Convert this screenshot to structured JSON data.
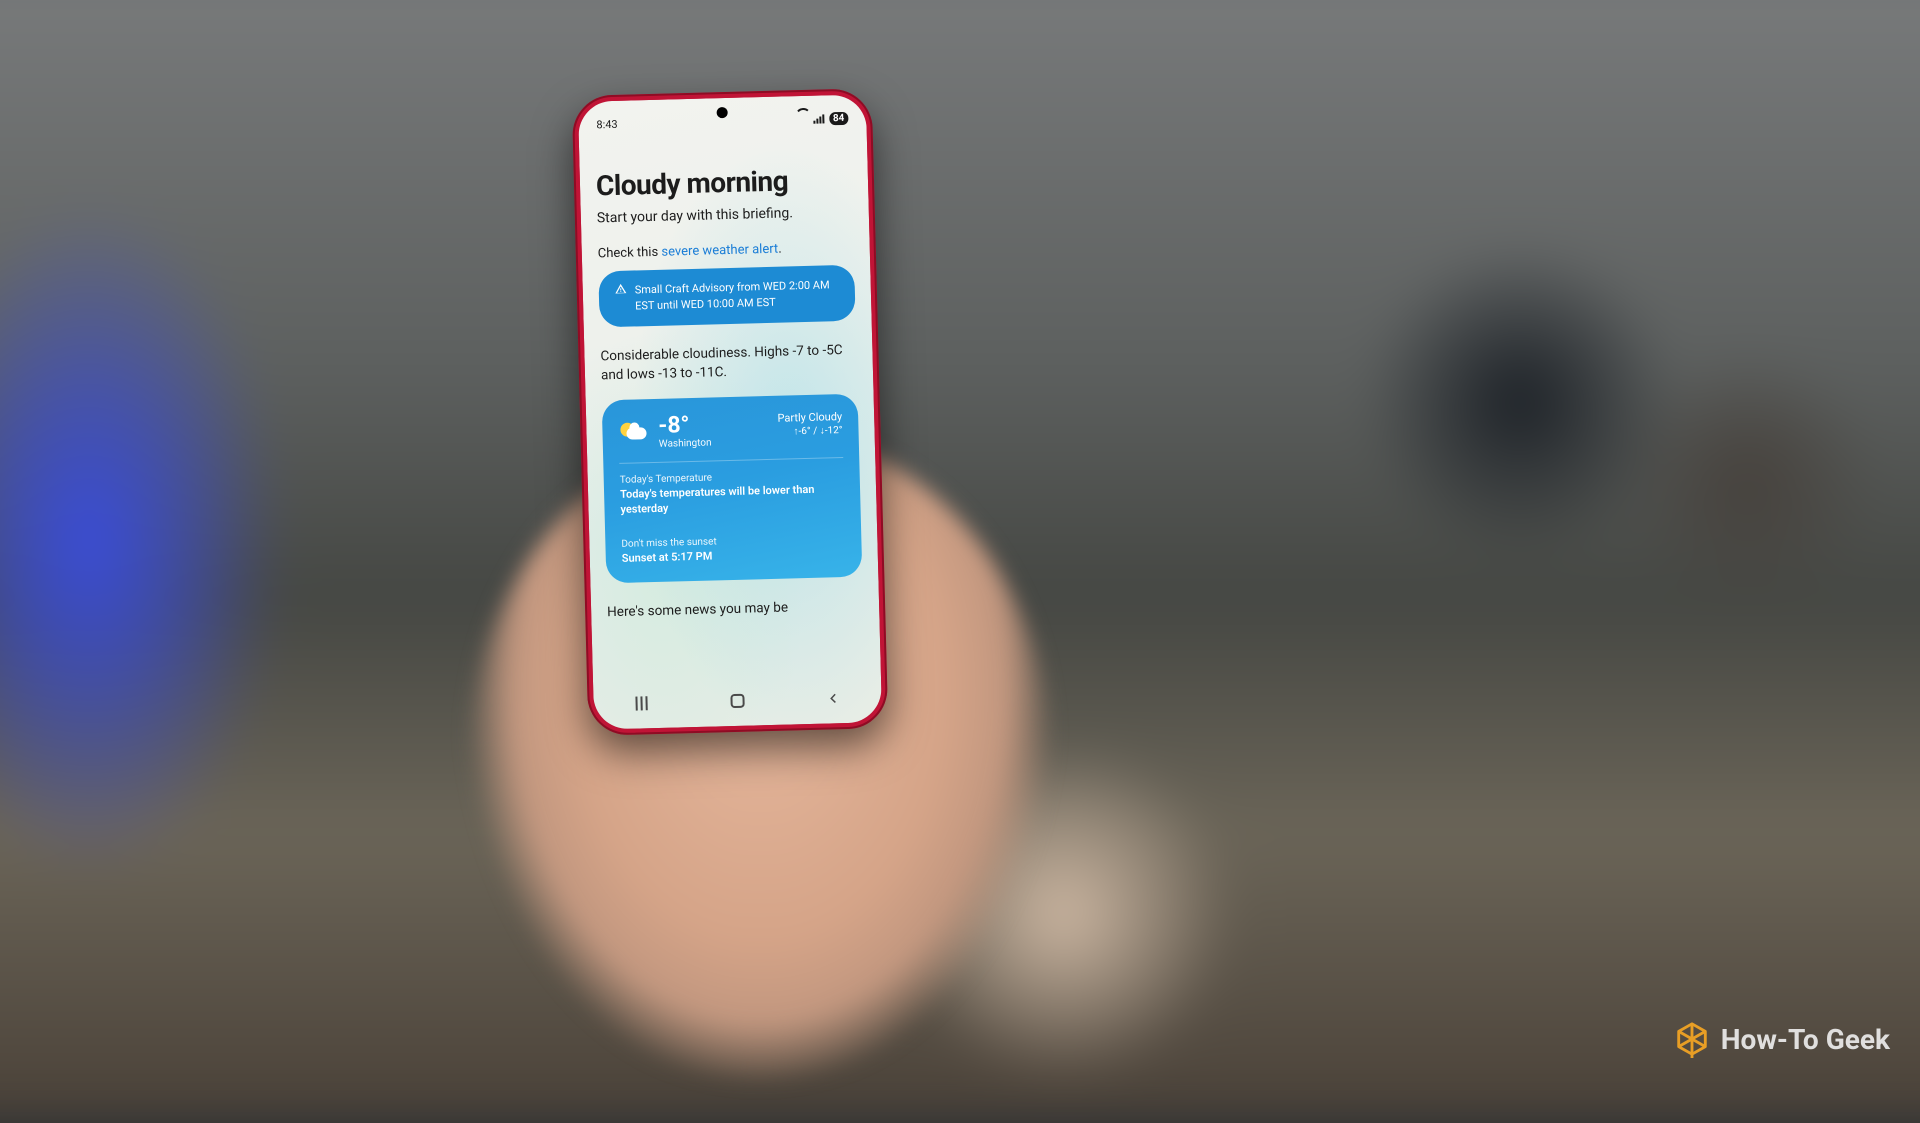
{
  "watermark": "How-To Geek",
  "status": {
    "time": "8:43",
    "battery": "84"
  },
  "briefing": {
    "title": "Cloudy morning",
    "subtitle": "Start your day with this briefing.",
    "check_prefix": "Check this ",
    "check_link": "severe weather alert",
    "check_suffix": ".",
    "advisory": "Small Craft Advisory from WED 2:00 AM EST until WED 10:00 AM EST",
    "forecast": "Considerable cloudiness. Highs -7 to -5C and lows -13 to -11C.",
    "news_lead": "Here's some news you may be"
  },
  "weather": {
    "temp": "-8°",
    "location": "Washington",
    "condition": "Partly Cloudy",
    "hilo": "↑-6° / ↓-12°",
    "today_label": "Today's Temperature",
    "today_value": "Today's temperatures will be lower than yesterday",
    "sunset_label": "Don't miss the sunset",
    "sunset_value": "Sunset at 5:17 PM"
  }
}
